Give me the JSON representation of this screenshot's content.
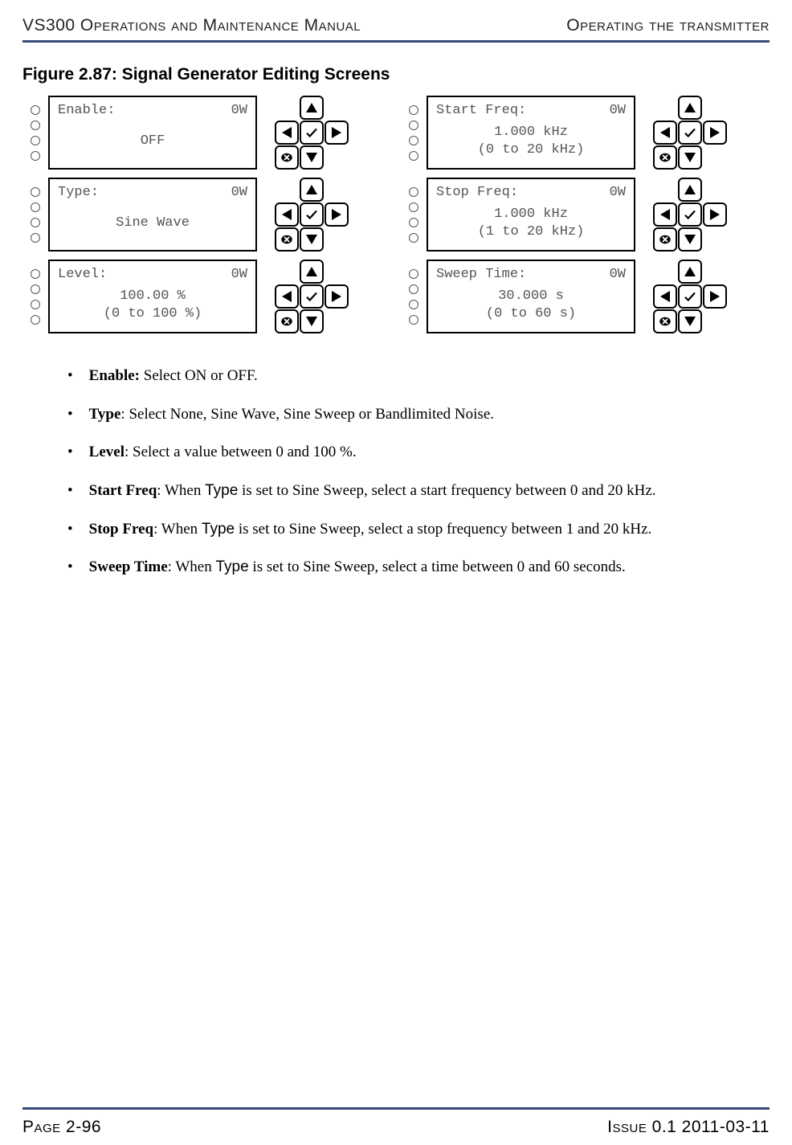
{
  "header": {
    "left": "VS300 Operations and Maintenance Manual",
    "right": "Operating the transmitter"
  },
  "figure": {
    "title": "Figure 2.87: Signal Generator Editing Screens"
  },
  "screens": [
    {
      "title": "Enable:",
      "power": "0W",
      "line1": "OFF",
      "line2": ""
    },
    {
      "title": "Start Freq:",
      "power": "0W",
      "line1": "1.000 kHz",
      "line2": "(0 to 20 kHz)"
    },
    {
      "title": "Type:",
      "power": "0W",
      "line1": "Sine Wave",
      "line2": ""
    },
    {
      "title": "Stop Freq:",
      "power": "0W",
      "line1": "1.000 kHz",
      "line2": "(1 to 20 kHz)"
    },
    {
      "title": "Level:",
      "power": "0W",
      "line1": "100.00 %",
      "line2": "(0 to 100 %)"
    },
    {
      "title": "Sweep Time:",
      "power": "0W",
      "line1": "30.000 s",
      "line2": "(0 to 60 s)"
    }
  ],
  "bullets": [
    {
      "label": "Enable:",
      "text": " Select ON or OFF."
    },
    {
      "label": "Type",
      "text": ": Select None, Sine Wave, Sine Sweep or Bandlimited Noise."
    },
    {
      "label": "Level",
      "text": ": Select a value between 0 and 100 %."
    },
    {
      "label": "Start Freq",
      "text_pre": ": When ",
      "type_word": "Type",
      "text_post": " is set to Sine Sweep, select a start frequency between 0 and 20 kHz."
    },
    {
      "label": "Stop Freq",
      "text_pre": ": When ",
      "type_word": "Type",
      "text_post": " is set to Sine Sweep, select a stop frequency between 1 and 20 kHz."
    },
    {
      "label": "Sweep Time",
      "text_pre": ": When ",
      "type_word": "Type",
      "text_post": " is set to Sine Sweep, select a time between 0 and 60 seconds."
    }
  ],
  "footer": {
    "left": "Page 2-96",
    "right": "Issue 0.1  2011-03-11"
  },
  "marker": "•"
}
